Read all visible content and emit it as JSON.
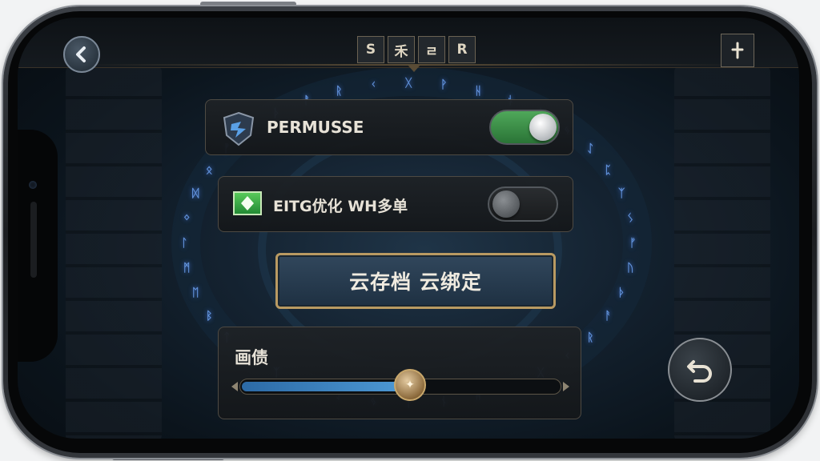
{
  "navigation": {
    "back_icon": "back-arrow-icon",
    "tabs": [
      {
        "label": "S"
      },
      {
        "label": "禾"
      },
      {
        "label": "ㄹ"
      },
      {
        "label": "R"
      }
    ],
    "menu_icon": "dagger-icon"
  },
  "settings": {
    "row1": {
      "icon": "shield-icon",
      "label": "PERMUSSE",
      "toggle_on": true
    },
    "row2": {
      "icon": "gem-icon",
      "label": "ЕITG优化 WH多单",
      "toggle_on": false
    }
  },
  "cloud_button": {
    "label": "云存档 云绑定"
  },
  "quality": {
    "title": "画债",
    "level": 0.53
  },
  "undo_icon": "undo-icon",
  "colors": {
    "toggle_on": "#3f9a4c",
    "accent_gold": "#b99a62",
    "slider_fill": "#3f86c6"
  }
}
